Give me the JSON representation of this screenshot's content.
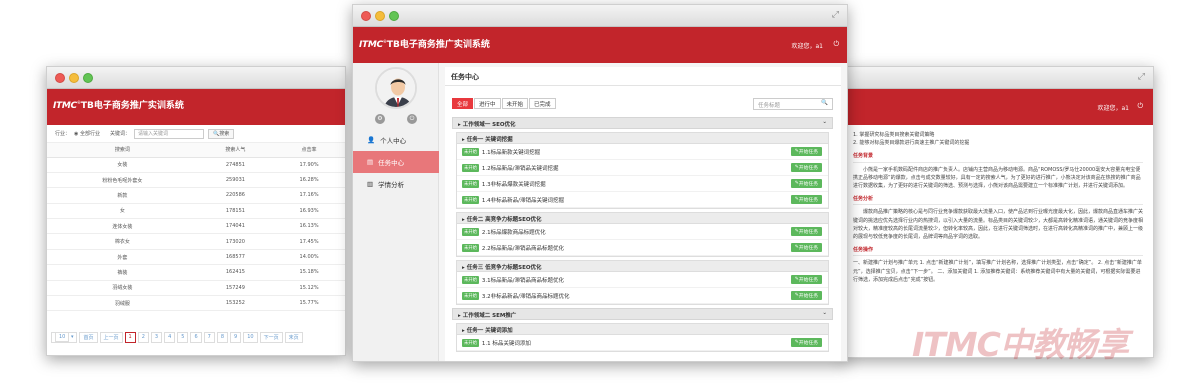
{
  "app_title": "TB电子商务推广实训系统",
  "logo_text": "ITMC",
  "logo_reg": "®",
  "welcome": "欢迎您，a1",
  "power_icon": "power-icon",
  "center": {
    "nav": [
      {
        "label": "个人中心",
        "icon": "user-icon"
      },
      {
        "label": "任务中心",
        "icon": "task-icon"
      },
      {
        "label": "学情分析",
        "icon": "chart-icon"
      }
    ],
    "panel_title": "任务中心",
    "tabs": [
      "全部",
      "进行中",
      "未开始",
      "已完成"
    ],
    "search_placeholder": "任务标题",
    "categories": [
      {
        "title": "工作领域一 SEO优化",
        "groups": [
          {
            "title": "任务一 关键词挖掘",
            "items": [
              "1.1标品新款关键词挖掘",
              "1.2标品新品/滞销品关键词挖掘",
              "1.3非标品爆款关键词挖掘",
              "1.4非标品新品/滞销品关键词挖掘"
            ]
          },
          {
            "title": "任务二 高竞争力标题SEO优化",
            "items": [
              "2.1标品爆款商品标题优化",
              "2.2标品新品/滞销品商品标题优化"
            ]
          },
          {
            "title": "任务三 低竞争力标题SEO优化",
            "items": [
              "3.1标品新品/滞销品商品标题优化",
              "3.2非标品新品/滞销品商品标题优化"
            ]
          }
        ]
      },
      {
        "title": "工作领域二 SEM推广",
        "groups": [
          {
            "title": "任务一 关键词添加",
            "items": [
              "1.1 标品关键词添加"
            ]
          }
        ]
      }
    ],
    "status_badge": "未开始",
    "start_label": "开始任务"
  },
  "left": {
    "filter_label": "行业：",
    "radio_label": "全部行业",
    "keyword_label": "关键词：",
    "keyword_placeholder": "请输入关键词",
    "search_btn": "搜索",
    "columns": [
      "搜索词",
      "搜索人气",
      "点击率"
    ],
    "rows": [
      [
        "女装",
        "274851",
        "17.90%"
      ],
      [
        "粉粉色毛呢外套女",
        "259031",
        "16.28%"
      ],
      [
        "新款",
        "220586",
        "17.16%"
      ],
      [
        "女",
        "178151",
        "16.93%"
      ],
      [
        "连体女装",
        "174041",
        "16.13%"
      ],
      [
        "棉衣女",
        "173020",
        "17.45%"
      ],
      [
        "外套",
        "168577",
        "14.00%"
      ],
      [
        "裤装",
        "162415",
        "15.18%"
      ],
      [
        "羽绒女装",
        "157249",
        "15.12%"
      ],
      [
        "羽绒服",
        "153252",
        "15.77%"
      ]
    ],
    "pager": {
      "page_size": "10",
      "first": "首页",
      "prev": "上一页",
      "pages": [
        "1",
        "2",
        "3",
        "4",
        "5",
        "6",
        "7",
        "8",
        "9",
        "10"
      ],
      "next": "下一页",
      "last": "末页"
    }
  },
  "right": {
    "intro_lines": [
      "1. 掌握研究标品类目搜索关键词策略",
      "2. 能够对标品类目爆款进行高速主推广关键词的挖掘"
    ],
    "sections": [
      {
        "title": "任务背景",
        "text": "小熊是一家手机数码配件商店的推广负责人。店铺内主营商品为移动电源。商品“ROMOSS/罗马仕20000毫安大容量充电宝便携正品移动电源”的爆款，点击与成交数量较好，具有一定的搜索人气，为了更好的进行推广，小熊决定对该商品在热搜的推广商品进行数据收集，为了更好的进行关键词的筛选、预测与选择，小熊对该商品需要建立一个标准推广计划，并进行关键词添加。"
      },
      {
        "title": "任务分析",
        "text": "爆款商品推广策略的核心是与同行业竞争爆款获取最大流量入口，使产品达到行业曝光度最大化，因此，爆款商品直通车推广关键词的挑选应优先选择行业内的热搜词，以引入大量的流量。标品类目的关键词较少，大都是高转化精准词语，通关键词的竞争度相对较大，精准度较高的长尾词流量较少，但转化率较高，因此，在进行关键词筛选时，在进行高转化高精准词的推广中，兼顾上一级的展现与较低竞争度的长尾词，品牌词等商品字词的选取。"
      },
      {
        "title": "任务操作",
        "text": "一、新建推广计划与推广单元 1. 点击“新建推广计划”，填写推广计划名称，选择推广计划类型，点击“确定”。 2. 点击“新建推广单元”，选择推广宝贝，点击“下一步”。 二、添加关键词 1. 添加推荐关键词：系统推荐关键词中有大量的关键词，可根据实际需要进行筛选，添加完成后点击“完成”按钮。"
      }
    ]
  },
  "watermark": "ITMC中教畅享"
}
